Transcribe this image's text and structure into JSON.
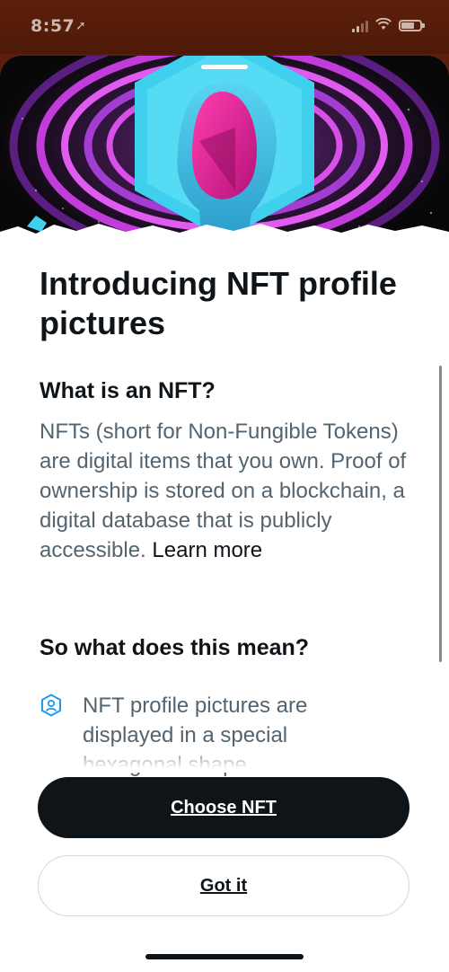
{
  "status_bar": {
    "time": "8:57",
    "location_icon": "location-arrow-icon",
    "signal_icon": "signal-bars-icon",
    "wifi_icon": "wifi-icon",
    "battery_icon": "battery-icon"
  },
  "modal": {
    "title": "Introducing NFT profile pictures",
    "section1_heading": "What is an NFT?",
    "section1_body": "NFTs (short for Non-Fungible Tokens) are digital items that you own. Proof of ownership is stored on a blockchain, a digital database that is publicly accessible.",
    "learn_more": "Learn more",
    "section2_heading": "So what does this mean?",
    "bullet1_icon": "hexagon-profile-icon",
    "bullet1_text": "NFT profile pictures are displayed in a special hexagonal shape"
  },
  "buttons": {
    "primary": "Choose NFT",
    "secondary": "Got it"
  },
  "colors": {
    "status_bar_bg": "#5a1e0a",
    "text_primary": "#0f1419",
    "text_secondary": "#536471",
    "accent_cyan": "#3fd0ee",
    "accent_magenta": "#e0239a",
    "accent_purple": "#a23fd8"
  }
}
